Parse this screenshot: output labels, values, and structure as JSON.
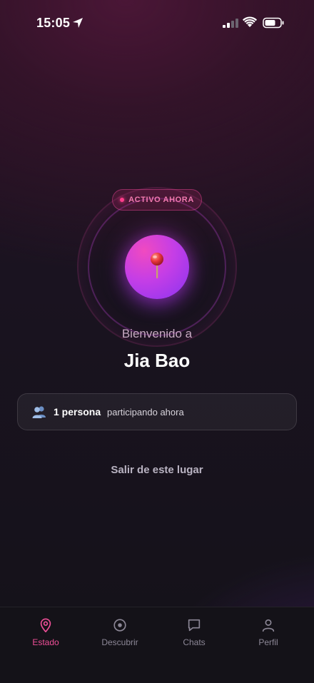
{
  "status_bar": {
    "time": "15:05"
  },
  "badge": {
    "label": "ACTIVO AHORA"
  },
  "welcome": {
    "greeting": "Bienvenido a",
    "place_name": "Jia Bao"
  },
  "people": {
    "count_label": "1 persona",
    "description": "participando ahora"
  },
  "actions": {
    "leave_label": "Salir de este lugar"
  },
  "nav": {
    "items": [
      {
        "label": "Estado",
        "icon": "map-pin-icon",
        "active": true
      },
      {
        "label": "Descubrir",
        "icon": "target-icon",
        "active": false
      },
      {
        "label": "Chats",
        "icon": "chat-bubble-icon",
        "active": false
      },
      {
        "label": "Perfil",
        "icon": "user-icon",
        "active": false
      }
    ]
  },
  "colors": {
    "accent": "#ef4f98",
    "orb_start": "#f04ac0",
    "orb_end": "#8a34f0",
    "inactive": "#8c8796"
  }
}
